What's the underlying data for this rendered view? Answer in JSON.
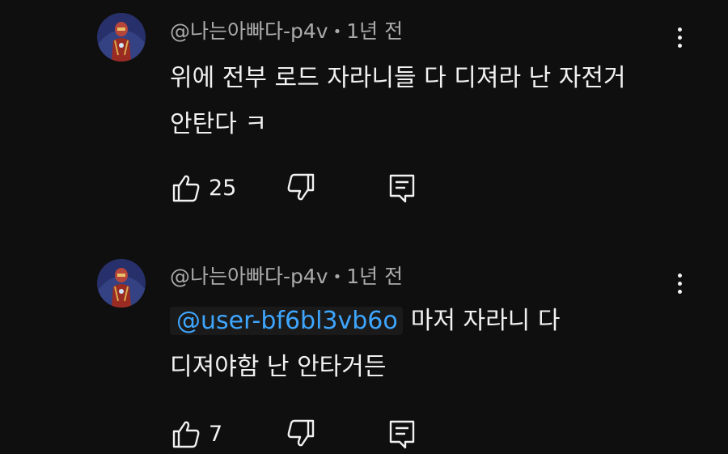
{
  "comments": [
    {
      "author": "@나는아빠다-p4v",
      "separator": "•",
      "time": "1년 전",
      "lines": [
        "위에 전부 로드 자라니들 다 디져라 난 자전거",
        "안탄다 ㅋ"
      ],
      "like_count": "25"
    },
    {
      "author": "@나는아빠다-p4v",
      "separator": "•",
      "time": "1년 전",
      "mention": "@user-bf6bl3vb6o",
      "line1_rest": "마저 자라니 다",
      "line2": "디져야함 난 안타거든",
      "like_count": "7"
    }
  ],
  "icons": {
    "avatar": "iron-man-avatar",
    "more": "more-vert-icon",
    "like": "thumb-up-icon",
    "dislike": "thumb-down-icon",
    "reply": "comment-reply-icon"
  },
  "colors": {
    "background": "#0f0f0f",
    "text": "#f1f1f1",
    "meta": "#aaaaaa",
    "mention": "#3ea6ff"
  }
}
